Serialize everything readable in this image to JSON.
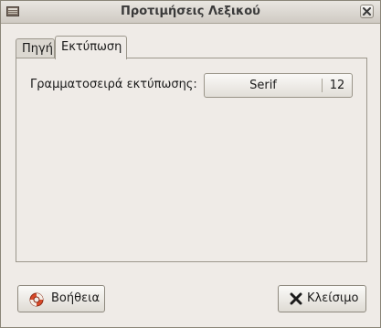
{
  "window": {
    "title": "Προτιμήσεις Λεξικού"
  },
  "tabs": [
    {
      "label": "Πηγή",
      "active": false
    },
    {
      "label": "Εκτύπωση",
      "active": true
    }
  ],
  "print_tab": {
    "font_label": "Γραμματοσειρά εκτύπωσης:",
    "font_name": "Serif",
    "font_size": "12"
  },
  "buttons": {
    "help_label": "Βοήθεια",
    "close_label": "Κλείσιμο"
  },
  "icons": {
    "window": "dictionary-icon",
    "titlebar_close": "close-icon",
    "help": "lifebuoy-icon",
    "close": "x-icon"
  },
  "colors": {
    "background": "#efebe7",
    "titlebar": "#cfcac3",
    "help_icon": "#d84a2a"
  }
}
